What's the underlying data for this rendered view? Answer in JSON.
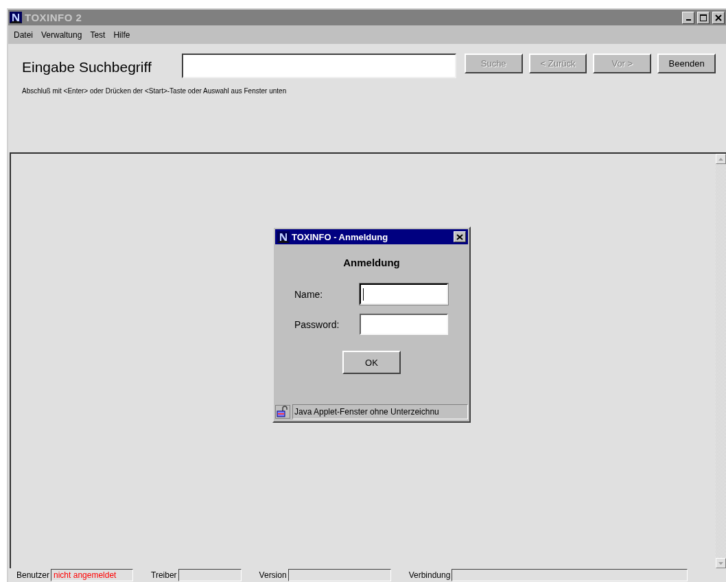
{
  "window": {
    "title": "TOXINFO 2"
  },
  "menu": [
    "Datei",
    "Verwaltung",
    "Test",
    "Hilfe"
  ],
  "search": {
    "label": "Eingabe Suchbegriff",
    "hint": "Abschluß mit <Enter> oder Drücken der <Start>-Taste oder Auswahl aus Fenster unten"
  },
  "buttons": [
    {
      "label": "Suche",
      "disabled": true
    },
    {
      "label": "< Zurück",
      "disabled": true
    },
    {
      "label": "Vor >",
      "disabled": true
    },
    {
      "label": "Beenden",
      "disabled": false
    }
  ],
  "dialog": {
    "title": "TOXINFO - Anmeldung",
    "heading": "Anmeldung",
    "fields": [
      {
        "label": "Name:",
        "focused": true
      },
      {
        "label": "Password:",
        "focused": false
      }
    ],
    "ok": "OK",
    "status": "Java Applet-Fenster ohne Unterzeichnu"
  },
  "status_bar": [
    {
      "label": "Benutzer",
      "value": "nicht angemeldet"
    },
    {
      "label": "Treiber"
    },
    {
      "label": "Version"
    },
    {
      "label": "Verbindung"
    }
  ]
}
